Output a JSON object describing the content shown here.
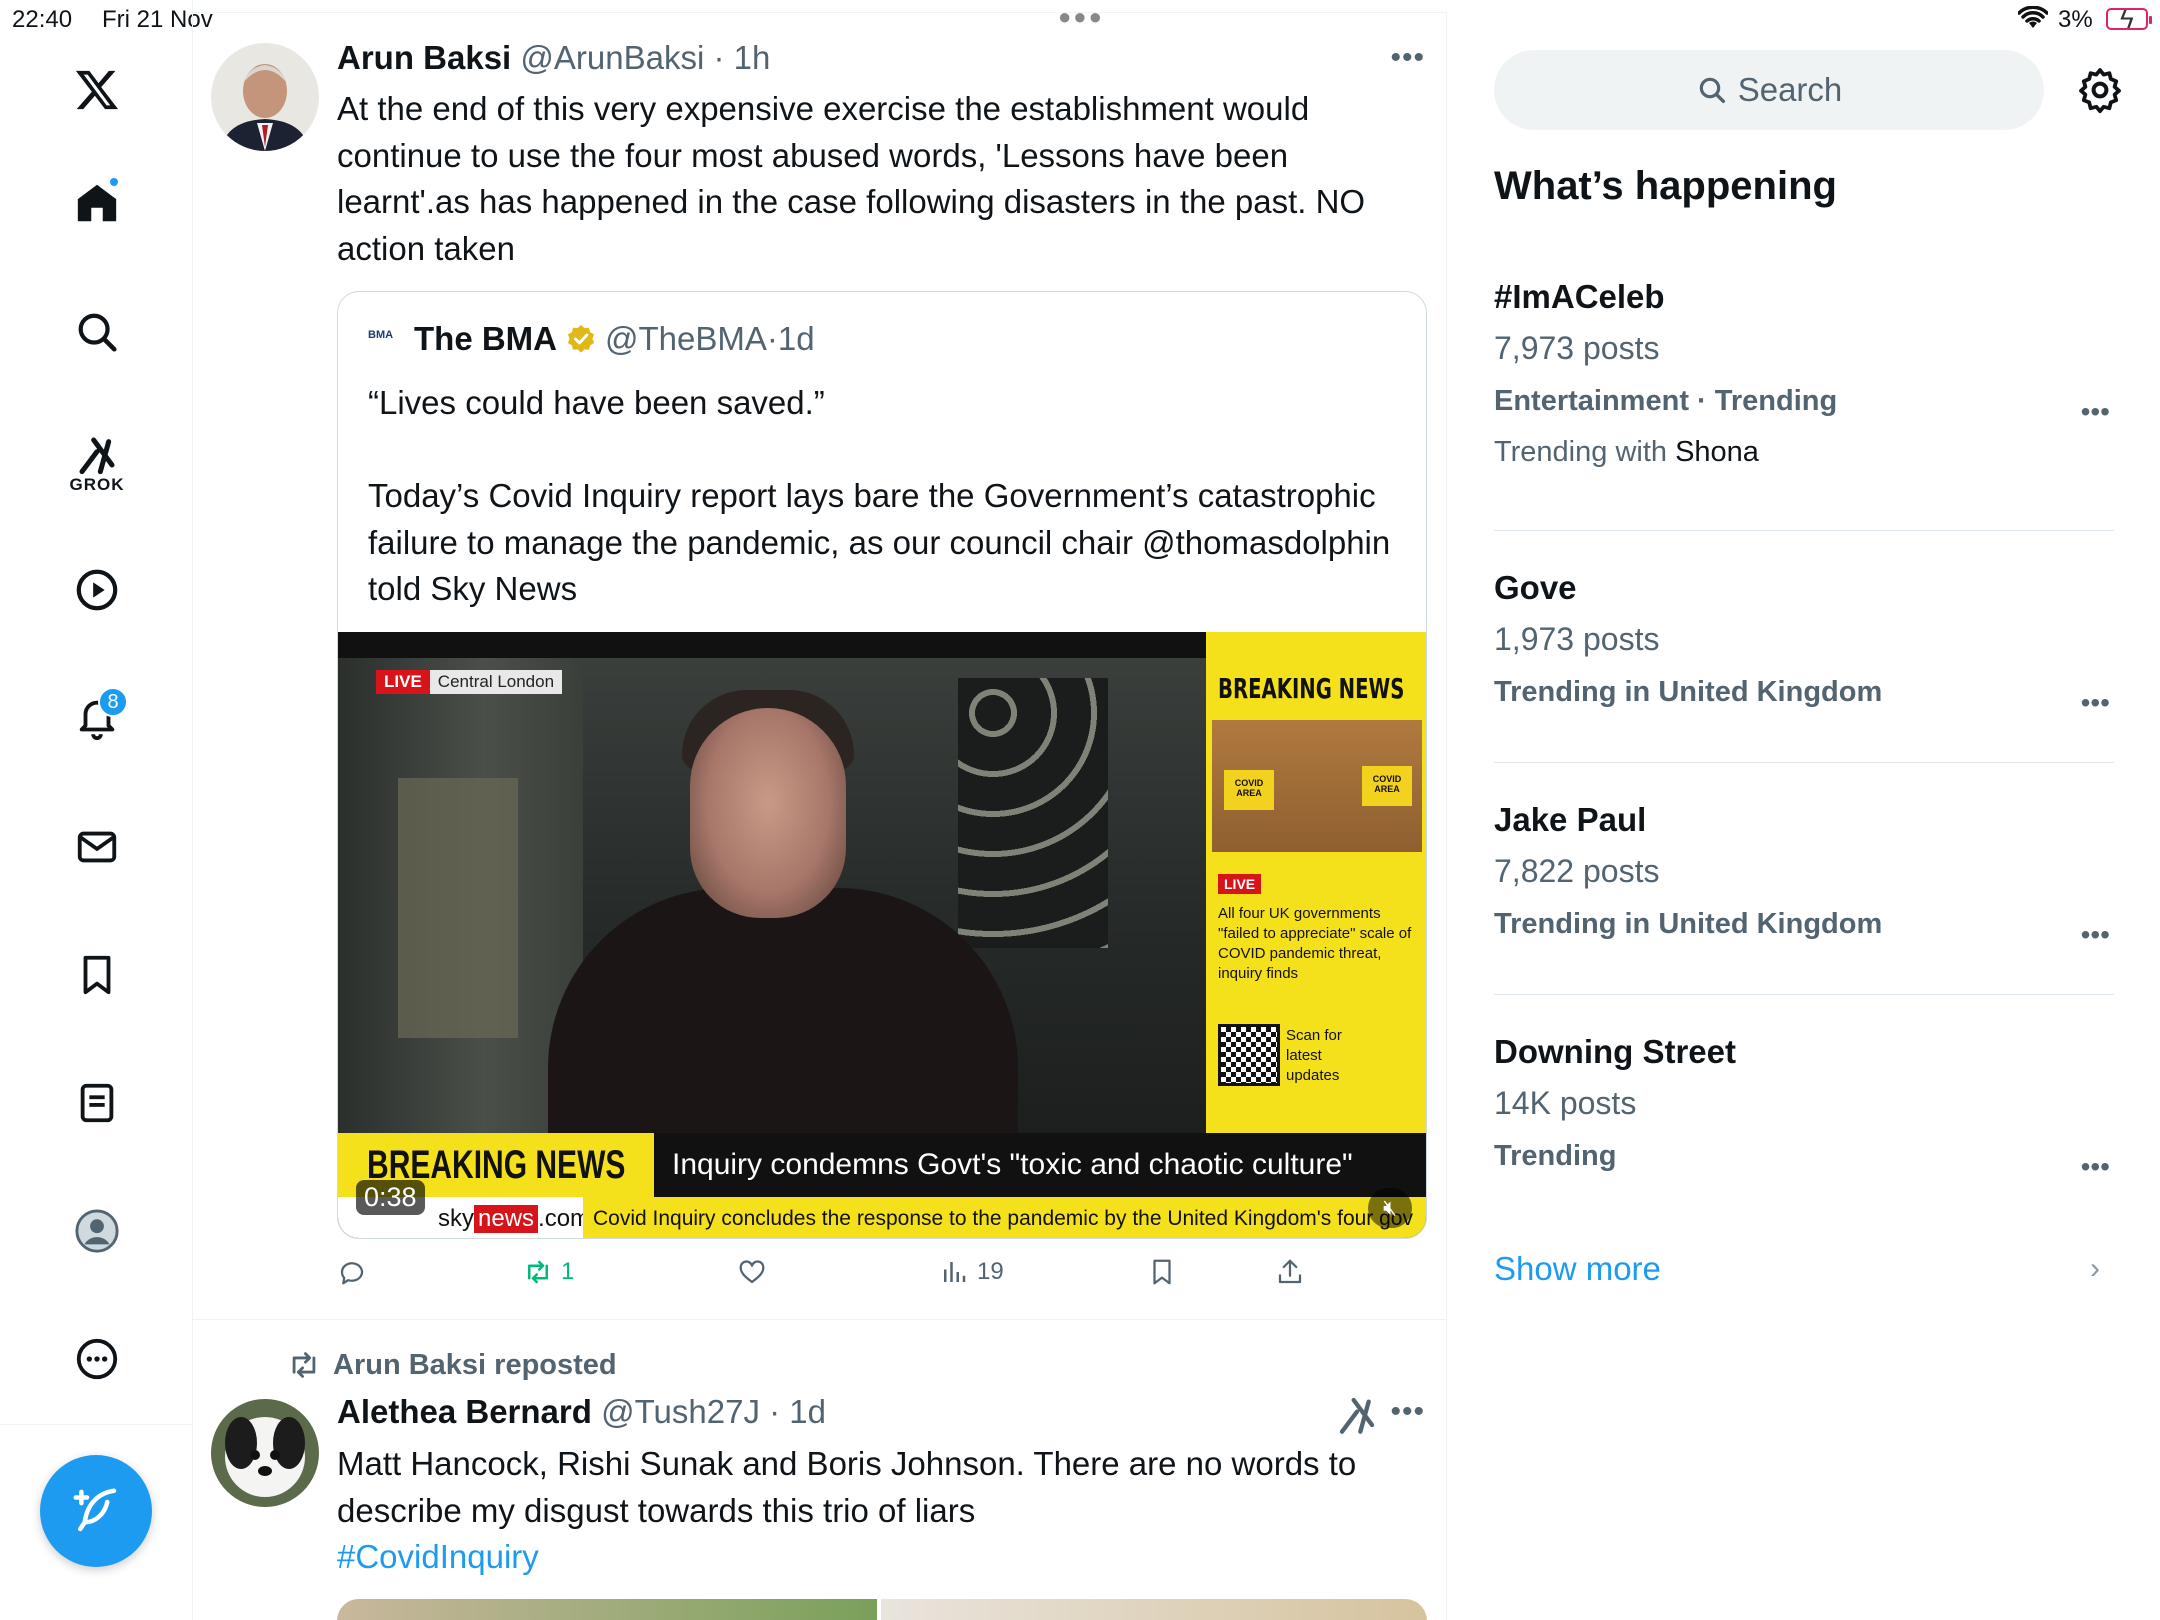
{
  "status_bar": {
    "time": "22:40",
    "date": "Fri 21 Nov",
    "battery": "3%"
  },
  "nav": {
    "grok_label": "GROK",
    "notifications_count": "8"
  },
  "tweet1": {
    "name": "Arun Baksi",
    "handle": "@ArunBaksi",
    "time": "1h",
    "text": "At the end of this very expensive exercise the establishment would continue to use the four most abused words, 'Lessons have been learnt'.as has happened in the case following disasters in the past. NO action taken",
    "quote": {
      "logo": "BMA",
      "name": "The BMA",
      "handle": "@TheBMA",
      "time": "1d",
      "text": "“Lives could have been saved.”\n\nToday’s Covid Inquiry report lays bare the Government’s catastrophic failure to manage the pandemic, as our council chair @thomasdolphin told Sky News",
      "video": {
        "live_tag": "LIVE",
        "location": "Central London",
        "side_title": "BREAKING NEWS",
        "side_live": "LIVE",
        "side_story": "All four UK governments \"failed to appreciate\" scale of COVID pandemic threat, inquiry finds",
        "scan_text": "Scan for latest updates",
        "covid_sign": "COVID AREA",
        "lower_third_title": "BREAKING NEWS",
        "headline": "Inquiry condemns Govt's \"toxic and chaotic culture\"",
        "brand_prefix": "sky",
        "brand_news": "news",
        "brand_suffix": ".com",
        "ticker": "Covid Inquiry concludes the response to the pandemic by the United Kingdom's four gov",
        "duration": "0:38"
      }
    },
    "actions": {
      "replies": "",
      "reposts": "1",
      "likes": "",
      "views": "19"
    }
  },
  "tweet2": {
    "repost_label": "Arun Baksi reposted",
    "name": "Alethea Bernard",
    "handle": "@Tush27J",
    "time": "1d",
    "text": "Matt Hancock, Rishi Sunak and Boris Johnson. There are no words to describe my disgust towards this trio of liars",
    "hashtag": "#CovidInquiry"
  },
  "sidebar": {
    "search_placeholder": "Search",
    "section_title": "What’s happening",
    "trends": [
      {
        "name": "#ImACeleb",
        "posts": "7,973 posts",
        "category": "Entertainment · Trending",
        "with_prefix": "Trending with",
        "with_name": "Shona"
      },
      {
        "name": "Gove",
        "posts": "1,973 posts",
        "category": "Trending in United Kingdom"
      },
      {
        "name": "Jake Paul",
        "posts": "7,822 posts",
        "category": "Trending in United Kingdom"
      },
      {
        "name": "Downing Street",
        "posts": "14K posts",
        "category": "Trending"
      }
    ],
    "show_more": "Show more"
  },
  "colors": {
    "accent": "#1d9bf0",
    "repost_green": "#00ba7c",
    "text": "#0f1419",
    "secondary": "#536471"
  }
}
